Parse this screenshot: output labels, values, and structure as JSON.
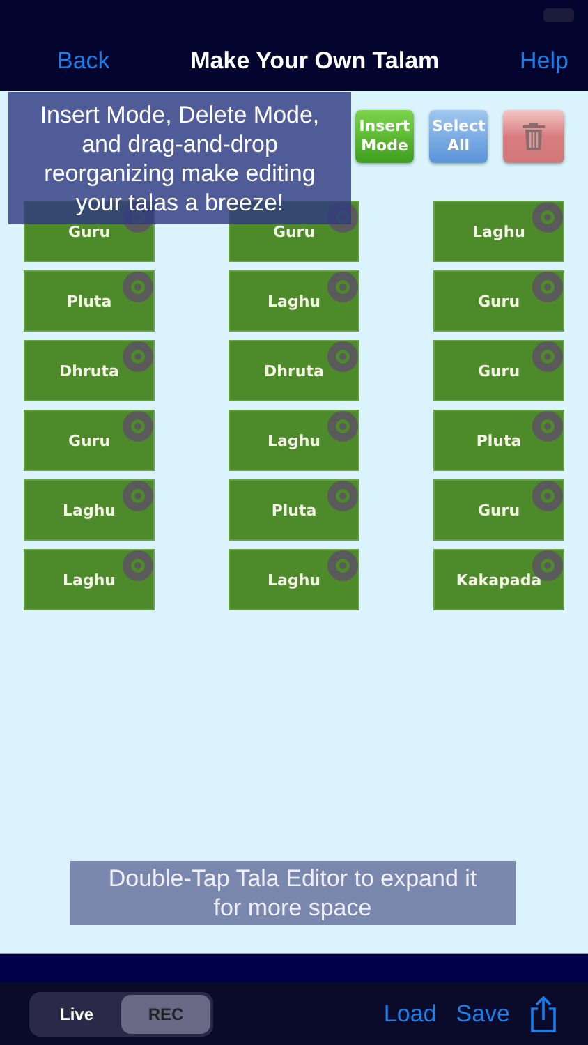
{
  "nav": {
    "back": "Back",
    "title": "Make Your Own Talam",
    "help": "Help"
  },
  "toolbar": [
    {
      "kind": "insert",
      "label": "Insert Mode"
    },
    {
      "kind": "select",
      "label": "Select All"
    },
    {
      "kind": "delete"
    }
  ],
  "tiles": [
    {
      "label": "Guru"
    },
    {
      "label": "Guru"
    },
    {
      "label": "Laghu"
    },
    {
      "label": "Pluta"
    },
    {
      "label": "Laghu"
    },
    {
      "label": "Guru"
    },
    {
      "label": "Dhruta"
    },
    {
      "label": "Dhruta"
    },
    {
      "label": "Guru"
    },
    {
      "label": "Guru"
    },
    {
      "label": "Laghu"
    },
    {
      "label": "Pluta"
    },
    {
      "label": "Laghu"
    },
    {
      "label": "Pluta"
    },
    {
      "label": "Guru"
    },
    {
      "label": "Laghu"
    },
    {
      "label": "Laghu"
    },
    {
      "label": "Kakapada"
    }
  ],
  "tips": [
    {
      "kind": "top",
      "text": "Insert Mode, Delete Mode, and drag-and-drop reorganizing make editing your talas a breeze!"
    },
    {
      "kind": "bottom",
      "text": "Double-Tap Tala Editor to expand it for more space"
    }
  ],
  "segments": [
    {
      "label": "Live",
      "selected": false
    },
    {
      "label": "REC",
      "selected": true
    }
  ],
  "actions": [
    "Load",
    "Save"
  ]
}
